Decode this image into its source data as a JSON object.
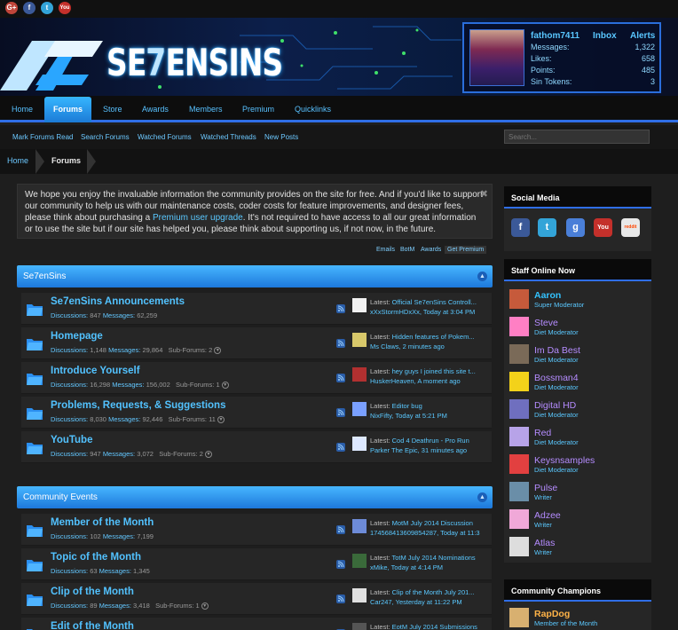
{
  "social_top": [
    "G+",
    "f",
    "t",
    "You"
  ],
  "site": {
    "logo_text_a": "SE",
    "logo_text_b": "7",
    "logo_text_c": "EN",
    "logo_text_d": "SINS"
  },
  "user": {
    "name": "fathom7411",
    "inbox": "Inbox",
    "alerts": "Alerts",
    "stats": [
      {
        "label": "Messages:",
        "value": "1,322"
      },
      {
        "label": "Likes:",
        "value": "658"
      },
      {
        "label": "Points:",
        "value": "485"
      },
      {
        "label": "Sin Tokens:",
        "value": "3"
      }
    ]
  },
  "nav": {
    "items": [
      "Home",
      "Forums",
      "Store",
      "Awards",
      "Members",
      "Premium",
      "Quicklinks"
    ],
    "active": "Forums"
  },
  "subnav": [
    "Mark Forums Read",
    "Search Forums",
    "Watched Forums",
    "Watched Threads",
    "New Posts"
  ],
  "search": {
    "placeholder": "Search..."
  },
  "breadcrumb": [
    "Home",
    "Forums"
  ],
  "notice": {
    "text_before": "We hope you enjoy the invaluable information the community provides on the site for free. And if you'd like to support our community to help us with our maintenance costs, coder costs for feature improvements, and designer fees, please think about purchasing a ",
    "link": "Premium user upgrade",
    "text_after": ". It's not required to have access to all our great information or to use the site but if our site has helped you, please think about supporting us, if not now, in the future.",
    "close": "✖",
    "links": [
      "Emails",
      "BotM",
      "Awards",
      "Get Premium"
    ]
  },
  "categories": [
    {
      "title": "Se7enSins",
      "forums": [
        {
          "name": "Se7enSins Announcements",
          "discussions": "847",
          "messages": "62,259",
          "subforums": "",
          "latest_title": "Official Se7enSins Controll...",
          "latest_by": "xXxStormHDxXx, Today at 3:04 PM"
        },
        {
          "name": "Homepage",
          "discussions": "1,148",
          "messages": "29,864",
          "subforums": "2",
          "latest_title": "Hidden features of Pokem...",
          "latest_by": "Ms Claws, 2 minutes ago"
        },
        {
          "name": "Introduce Yourself",
          "discussions": "16,298",
          "messages": "156,002",
          "subforums": "1",
          "latest_title": "hey guys I joined this site t...",
          "latest_by": "HuskerHeaven, A moment ago"
        },
        {
          "name": "Problems, Requests, & Suggestions",
          "discussions": "8,030",
          "messages": "92,446",
          "subforums": "11",
          "latest_title": "Editor bug",
          "latest_by": "NixFifty, Today at 5:21 PM"
        },
        {
          "name": "YouTube",
          "discussions": "947",
          "messages": "3,072",
          "subforums": "2",
          "latest_title": "Cod 4 Deathrun - Pro Run",
          "latest_by": "Parker The Epic, 31 minutes ago"
        }
      ]
    },
    {
      "title": "Community Events",
      "forums": [
        {
          "name": "Member of the Month",
          "discussions": "102",
          "messages": "7,199",
          "subforums": "",
          "latest_title": "MotM July 2014 Discussion",
          "latest_by": "17456841360985428​7, Today at 11:3"
        },
        {
          "name": "Topic of the Month",
          "discussions": "63",
          "messages": "1,345",
          "subforums": "",
          "latest_title": "TotM July 2014 Nominations",
          "latest_by": "xMike, Today at 4:14 PM"
        },
        {
          "name": "Clip of the Month",
          "discussions": "89",
          "messages": "3,418",
          "subforums": "1",
          "latest_title": "Clip of the Month July 201...",
          "latest_by": "Car247, Yesterday at 11:22 PM"
        },
        {
          "name": "Edit of the Month",
          "discussions": "",
          "messages": "",
          "subforums": "",
          "latest_title": "EotM July 2014 Submissions",
          "latest_by": ""
        }
      ]
    }
  ],
  "labels": {
    "latest": "Latest:",
    "discussions": "Discussions:",
    "messages": "Messages:",
    "subforums": "Sub-Forums:"
  },
  "sidebar": {
    "social_title": "Social Media",
    "social_icons": [
      "f",
      "t",
      "g",
      "You",
      "reddit"
    ],
    "staff_title": "Staff Online Now",
    "staff": [
      {
        "name": "Aaron",
        "role": "Super Moderator",
        "color": "#33c3ff",
        "avatar": "#c65a3b"
      },
      {
        "name": "Steve",
        "role": "Diet Moderator",
        "color": "#b58cff",
        "avatar": "#ff7fc4"
      },
      {
        "name": "Im Da Best",
        "role": "Diet Moderator",
        "color": "#b58cff",
        "avatar": "#7a6a58"
      },
      {
        "name": "Bossman4",
        "role": "Diet Moderator",
        "color": "#b58cff",
        "avatar": "#f3d21a"
      },
      {
        "name": "Digital HD",
        "role": "Diet Moderator",
        "color": "#b58cff",
        "avatar": "#6f6fbf"
      },
      {
        "name": "Red",
        "role": "Diet Moderator",
        "color": "#b58cff",
        "avatar": "#b7a3e8"
      },
      {
        "name": "Keysnsamples",
        "role": "Diet Moderator",
        "color": "#b58cff",
        "avatar": "#e24040"
      },
      {
        "name": "Pulse",
        "role": "Writer",
        "color": "#b58cff",
        "avatar": "#6a8ea8"
      },
      {
        "name": "Adzee",
        "role": "Writer",
        "color": "#b58cff",
        "avatar": "#f0a8d8"
      },
      {
        "name": "Atlas",
        "role": "Writer",
        "color": "#b58cff",
        "avatar": "#dddddd"
      }
    ],
    "champ_title": "Community Champions",
    "champ": {
      "name": "RapDog",
      "role": "Member of the Month"
    }
  },
  "colors": {
    "accent": "#2f6ee6",
    "link": "#52c2ff",
    "category": "#2b8ff0"
  }
}
